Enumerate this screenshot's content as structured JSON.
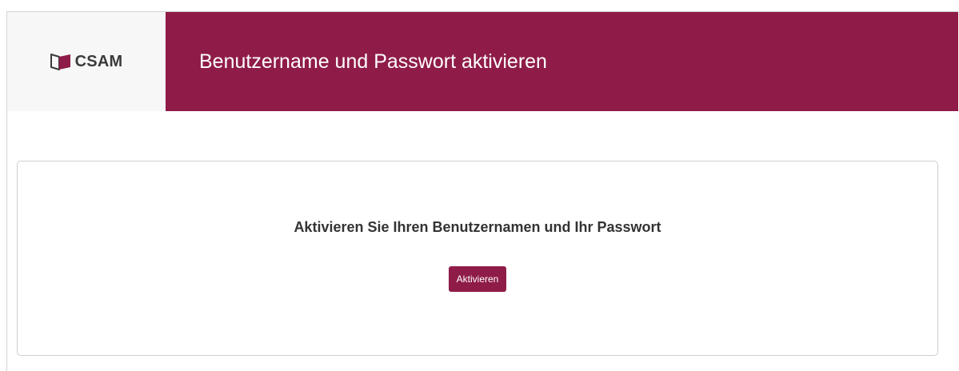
{
  "header": {
    "logo_text": "CSAM",
    "title": "Benutzername und Passwort aktivieren"
  },
  "main": {
    "heading": "Aktivieren Sie Ihren Benutzernamen und Ihr Passwort",
    "activate_button_label": "Aktivieren"
  },
  "colors": {
    "brand": "#8f1c48",
    "logo_text": "#3b3b3b",
    "logo_background": "#f7f7f7"
  },
  "icons": {
    "logo": "door-logo-icon"
  }
}
